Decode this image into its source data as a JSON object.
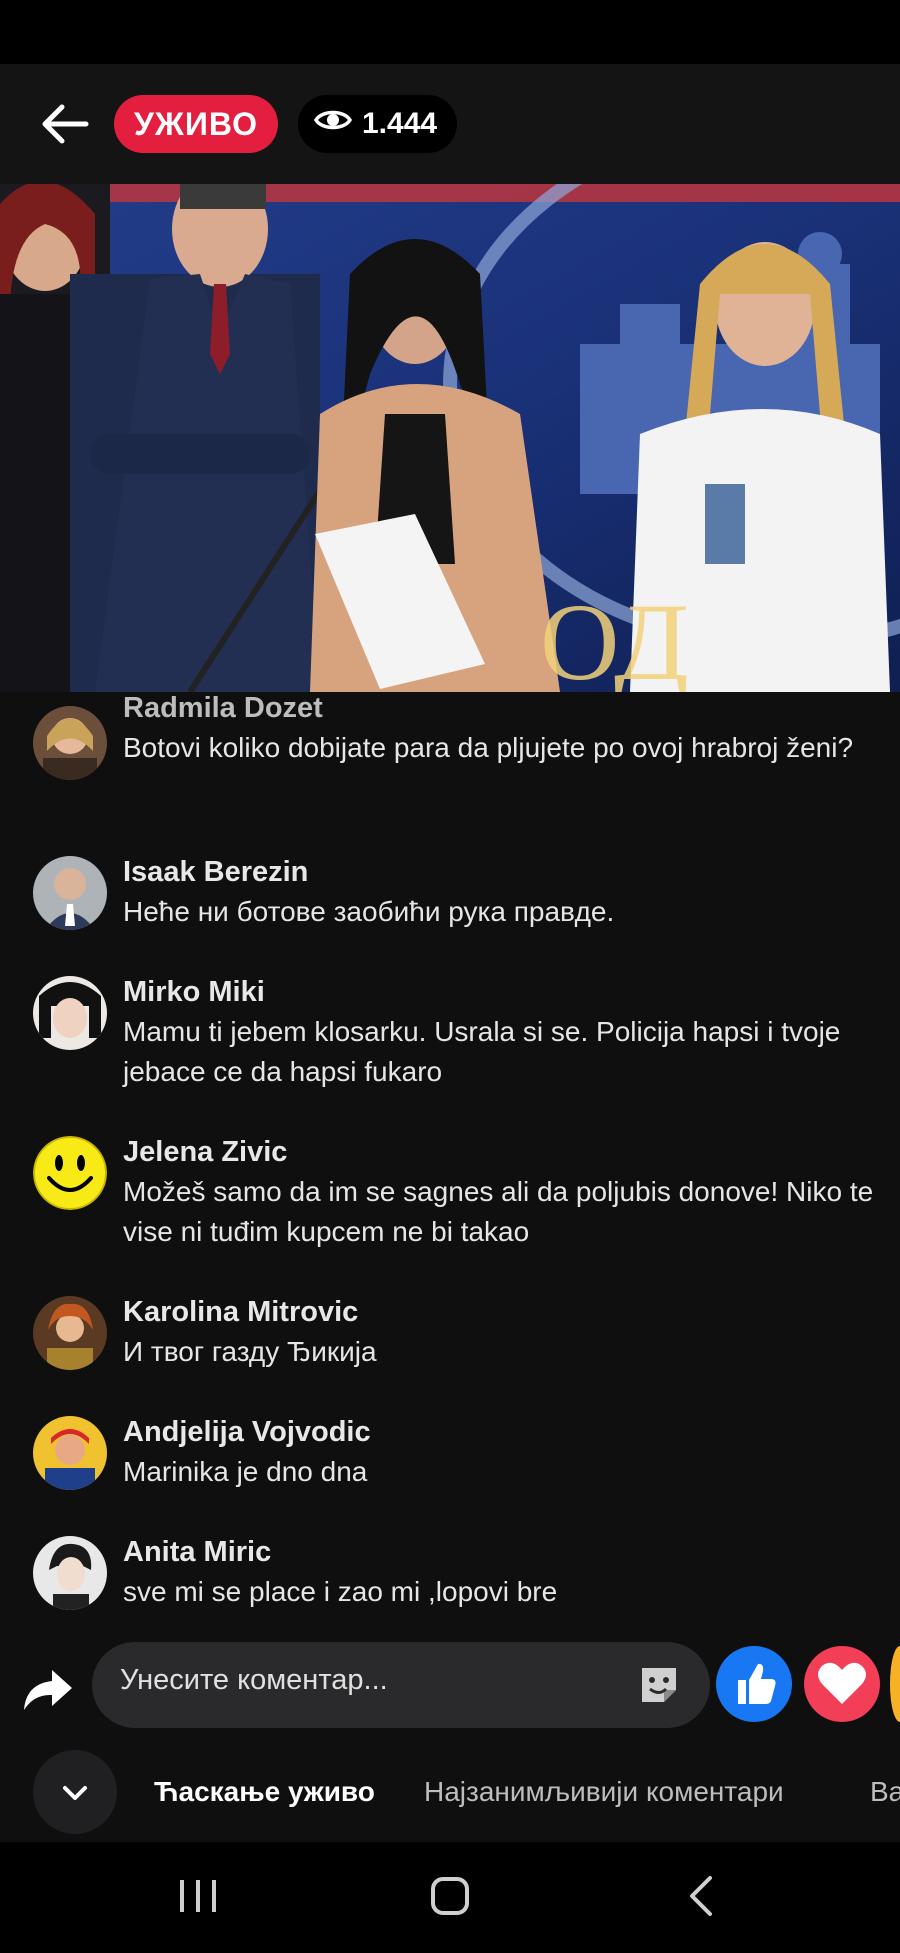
{
  "header": {
    "live_label": "УЖИВО",
    "viewer_count": "1.444"
  },
  "comments": [
    {
      "name": "Radmila Dozet",
      "text": "Botovi koliko dobijate para da pljujete po ovoj hrabroj ženi?"
    },
    {
      "name": "Isaak Berezin",
      "text": "Нeћe ни ботове заобићи рука правде."
    },
    {
      "name": "Mirko Miki",
      "text": "Mamu ti jebem klosarku. Usrala si se. Policija hapsi i tvoje jebace ce da hapsi fukaro"
    },
    {
      "name": "Jelena Zivic",
      "text": "Možeš samo da im se sagnes ali da poljubis donove! Niko te vise ni tuđim kupcem ne bi takao"
    },
    {
      "name": "Karolina Mitrovic",
      "text": "И твог газду Ђикија"
    },
    {
      "name": "Andjelija Vojvodic",
      "text": "Marinika je dno dna"
    },
    {
      "name": "Anita Miric",
      "text": "sve mi se place i zao mi ,lopovi bre"
    }
  ],
  "composer": {
    "placeholder": "Унесите коментар..."
  },
  "tabs": [
    {
      "label": "Ћаскање уживо"
    },
    {
      "label": "Најзанимљивији коментари"
    },
    {
      "label": "Ва"
    }
  ],
  "colors": {
    "live_red": "#e41e3f",
    "like_blue": "#1877f2",
    "love_red": "#f33e58"
  }
}
